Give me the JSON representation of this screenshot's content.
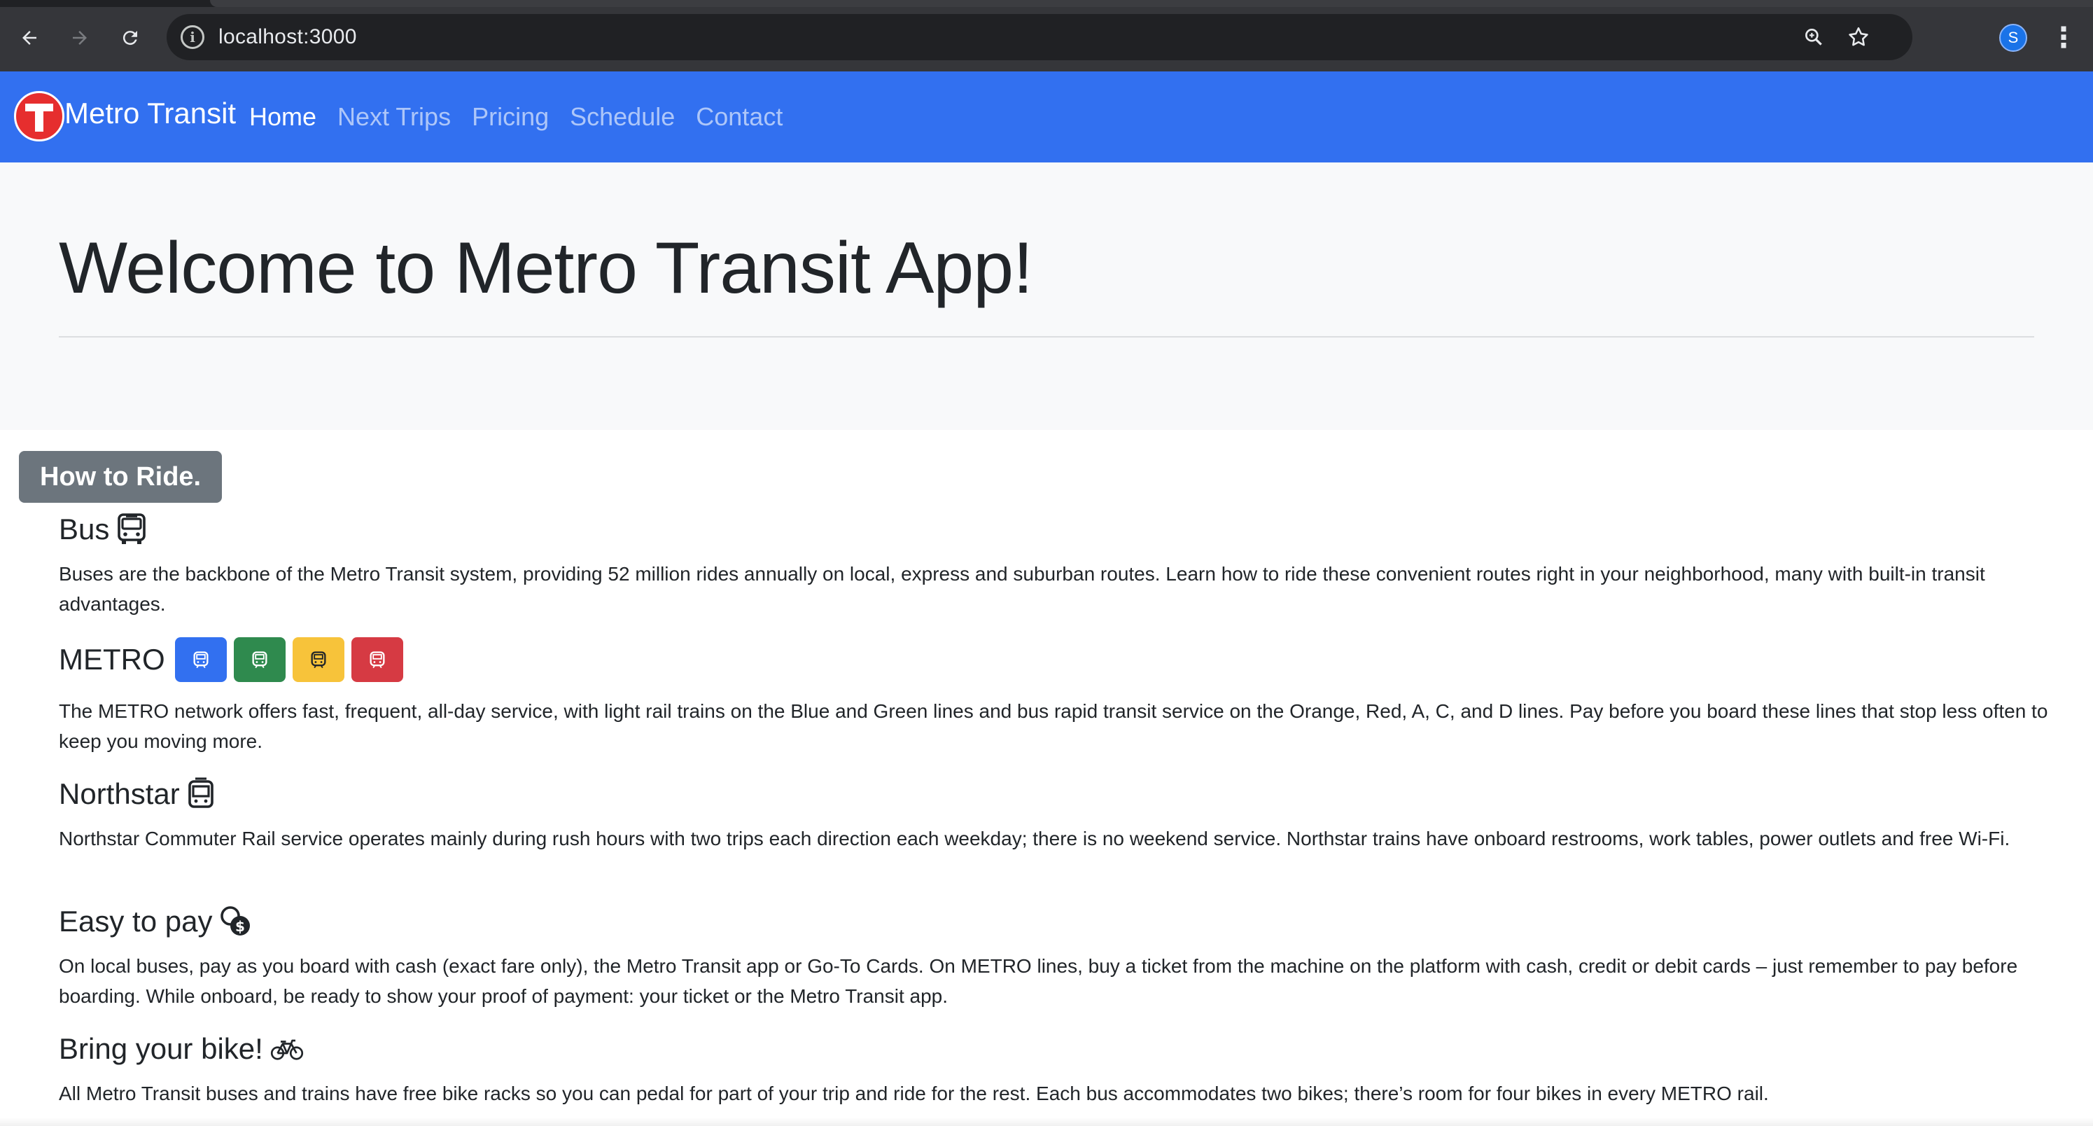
{
  "browser": {
    "url": "localhost:3000",
    "avatar_initial": "S",
    "icons": [
      "back-arrow-icon",
      "forward-arrow-icon",
      "reload-icon",
      "info-icon",
      "zoom-icon",
      "star-icon",
      "kebab-menu-icon"
    ]
  },
  "navbar": {
    "brand": "Metro Transit",
    "links": [
      {
        "label": "Home",
        "active": true
      },
      {
        "label": "Next Trips",
        "active": false
      },
      {
        "label": "Pricing",
        "active": false
      },
      {
        "label": "Schedule",
        "active": false
      },
      {
        "label": "Contact",
        "active": false
      }
    ]
  },
  "hero": {
    "title": "Welcome to Metro Transit App!"
  },
  "how_to_ride": {
    "badge": "How to Ride.",
    "sections": [
      {
        "title": "Bus",
        "icon": "bus-icon",
        "text": "Buses are the backbone of the Metro Transit system, providing 52 million rides annually on local, express and suburban routes. Learn how to ride these convenient routes right in your neighborhood, many with built-in transit advantages."
      },
      {
        "title": "METRO",
        "icon": "metro-train-icon",
        "text": "The METRO network offers fast, frequent, all-day service, with light rail trains on the Blue and Green lines and bus rapid transit service on the Orange, Red, A, C, and D lines. Pay before you board these lines that stop less often to keep you moving more."
      },
      {
        "title": "Northstar",
        "icon": "train-icon",
        "text": "Northstar Commuter Rail service operates mainly during rush hours with two trips each direction each weekday; there is no weekend service. Northstar trains have onboard restrooms, work tables, power outlets and free Wi-Fi."
      },
      {
        "title": "Easy to pay",
        "icon": "coins-icon",
        "text": "On local buses, pay as you board with cash (exact fare only), the Metro Transit app or Go-To Cards. On METRO lines, buy a ticket from the machine on the platform with cash, credit or debit cards – just remember to pay before boarding. While onboard, be ready to show your proof of payment: your ticket or the Metro Transit app."
      },
      {
        "title": "Bring your bike!",
        "icon": "bicycle-icon",
        "text": "All Metro Transit buses and trains have free bike racks so you can pedal for part of your trip and ride for the rest. Each bus accommodates two bikes; there’s room for four bikes in every METRO rail."
      }
    ],
    "metro_line_colors": [
      "#3270f0",
      "#2f8a4e",
      "#f7c33a",
      "#d63a43"
    ]
  },
  "colors": {
    "navbar": "#3270f0",
    "hero_bg": "#f8f9fa",
    "badge_bg": "#6c757d",
    "logo_red": "#e62e2e"
  }
}
